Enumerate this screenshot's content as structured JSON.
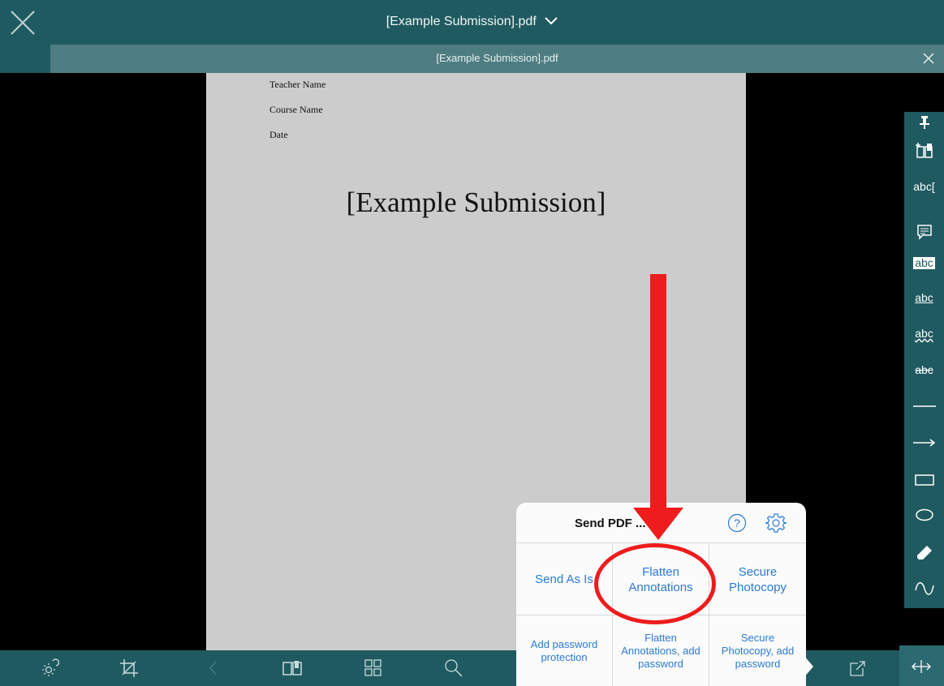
{
  "app": {
    "title": "[Example Submission].pdf",
    "tab_label": "[Example Submission].pdf"
  },
  "document": {
    "teacher": "Teacher Name",
    "course": "Course Name",
    "date": "Date",
    "title": "[Example Submission]"
  },
  "annotation_tools": [
    {
      "icon": "pin-icon"
    },
    {
      "icon": "add-bookmark-icon"
    },
    {
      "icon": "text-insert-icon",
      "label": "abc"
    },
    {
      "icon": "comment-icon"
    },
    {
      "icon": "highlight-icon",
      "label": "abc"
    },
    {
      "icon": "underline-icon",
      "label": "abc"
    },
    {
      "icon": "squiggly-icon",
      "label": "abc"
    },
    {
      "icon": "strikeout-icon",
      "label": "abc"
    },
    {
      "icon": "line-icon"
    },
    {
      "icon": "arrow-icon"
    },
    {
      "icon": "rectangle-icon"
    },
    {
      "icon": "ellipse-icon"
    },
    {
      "icon": "eraser-icon"
    },
    {
      "icon": "freehand-icon"
    }
  ],
  "bottom_toolbar": [
    "brightness-icon",
    "crop-icon",
    "back-chevron-icon",
    "book-icon",
    "grid-icon",
    "search-icon",
    "share-icon",
    "split-icon"
  ],
  "popover": {
    "title": "Send PDF ...",
    "options": [
      "Send As Is",
      "Flatten Annotations",
      "Secure Photocopy",
      "Add password protection",
      "Flatten Annotations, add password",
      "Secure Photocopy, add password"
    ]
  },
  "colors": {
    "toolbar": "#1f5a60",
    "accent": "#2a7bd1",
    "highlight": "#ee1c1c"
  }
}
